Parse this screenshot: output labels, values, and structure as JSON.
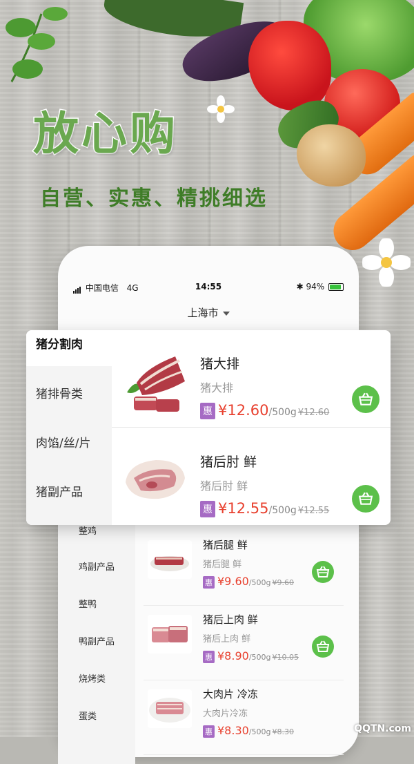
{
  "slogan": {
    "title": "放心购",
    "subtitle": "自营、实惠、精挑细选"
  },
  "status_bar": {
    "carrier": "中国电信",
    "network": "4G",
    "time": "14:55",
    "battery": "94%"
  },
  "city": "上海市",
  "phone_sidebar": [
    "整鸡",
    "鸡副产品",
    "整鸭",
    "鸭副产品",
    "烧烤类",
    "蛋类"
  ],
  "phone_products": [
    {
      "name": "猪后腿 鲜",
      "sub": "猪后腿 鲜",
      "badge": "惠",
      "price": "¥9.60",
      "unit": "/500g",
      "old": "¥9.60"
    },
    {
      "name": "猪后上肉 鲜",
      "sub": "猪后上肉 鲜",
      "badge": "惠",
      "price": "¥8.90",
      "unit": "/500g",
      "old": "¥10.05"
    },
    {
      "name": "大肉片 冷冻",
      "sub": "大肉片冷冻",
      "badge": "惠",
      "price": "¥8.30",
      "unit": "/500g",
      "old": "¥8.30"
    }
  ],
  "popup": {
    "categories": [
      "猪分割肉",
      "猪排骨类",
      "肉馅/丝/片",
      "猪副产品"
    ],
    "products": [
      {
        "name": "猪大排",
        "sub": "猪大排",
        "badge": "惠",
        "price": "¥12.60",
        "unit": "/500g",
        "old": "¥12.60"
      },
      {
        "name": "猪后肘 鲜",
        "sub": "猪后肘 鲜",
        "badge": "惠",
        "price": "¥12.55",
        "unit": "/500g",
        "old": "¥12.55"
      }
    ]
  },
  "watermark": "QQTN.com",
  "colors": {
    "brand_green": "#5cc04a",
    "price_red": "#e8412f",
    "badge_purple": "#a66bc4"
  },
  "icons": [
    "basket-icon",
    "bluetooth-icon",
    "battery-icon",
    "signal-icon",
    "dropdown-caret-icon"
  ]
}
